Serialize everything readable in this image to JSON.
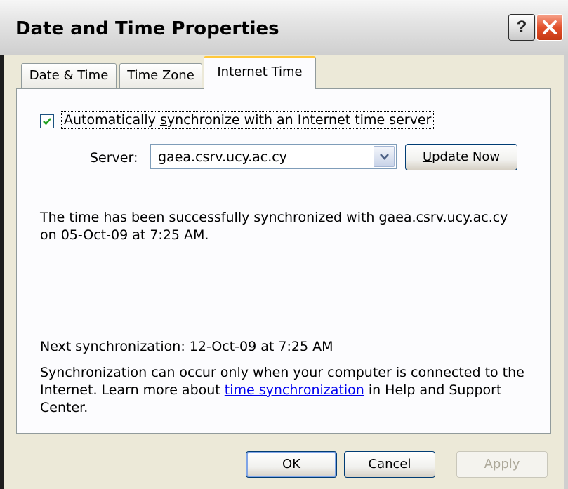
{
  "window": {
    "title": "Date and Time Properties"
  },
  "titlebar": {
    "help_label": "?"
  },
  "tabs": [
    {
      "label": "Date & Time"
    },
    {
      "label": "Time Zone"
    },
    {
      "label": "Internet Time"
    }
  ],
  "sync": {
    "checkbox_checked": true,
    "checkbox_pre": "Automatically ",
    "checkbox_u": "s",
    "checkbox_post": "ynchronize with an Internet time server",
    "server_label": "Server:",
    "server_value": "gaea.csrv.ucy.ac.cy",
    "update_pre": "",
    "update_u": "U",
    "update_post": "pdate Now"
  },
  "status": {
    "line1": "The time has been successfully synchronized with gaea.csrv.ucy.ac.cy",
    "line2": "on 05-Oct-09 at 7:25 AM.",
    "next_sync": "Next synchronization: 12-Oct-09 at 7:25 AM",
    "info1": "Synchronization can occur only when your computer is connected to the",
    "info2_pre": "Internet.  Learn more about ",
    "info2_link": "time synchronization",
    "info2_post": " in Help and Support",
    "info3": "Center."
  },
  "footer": {
    "ok": "OK",
    "cancel": "Cancel",
    "apply_u": "A",
    "apply_post": "pply"
  },
  "colors": {
    "accent_tab": "#ffc83c",
    "close_red": "#e2502b",
    "link": "#0000ee"
  }
}
